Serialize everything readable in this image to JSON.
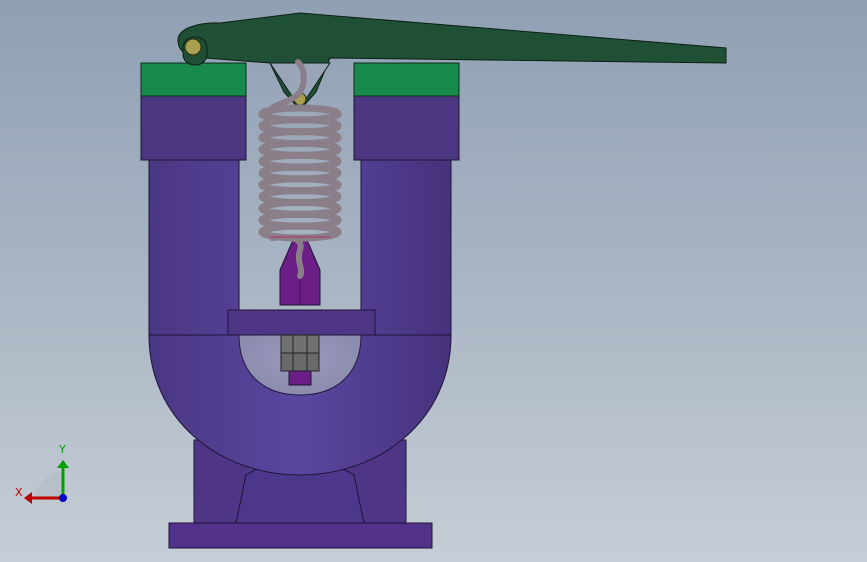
{
  "triad": {
    "x_label": "X",
    "y_label": "Y",
    "x_color": "#c00000",
    "y_color": "#00a000",
    "z_color": "#0000c0"
  },
  "model": {
    "body_color": "#4e3a86",
    "lever_color": "#1f5035",
    "green_cap_color": "#178a4c",
    "spring_color": "#8a7f88",
    "nut_color": "#6d6d6d",
    "rod_color": "#6a1e86"
  },
  "icons": [
    "coordinate-triad-icon"
  ]
}
